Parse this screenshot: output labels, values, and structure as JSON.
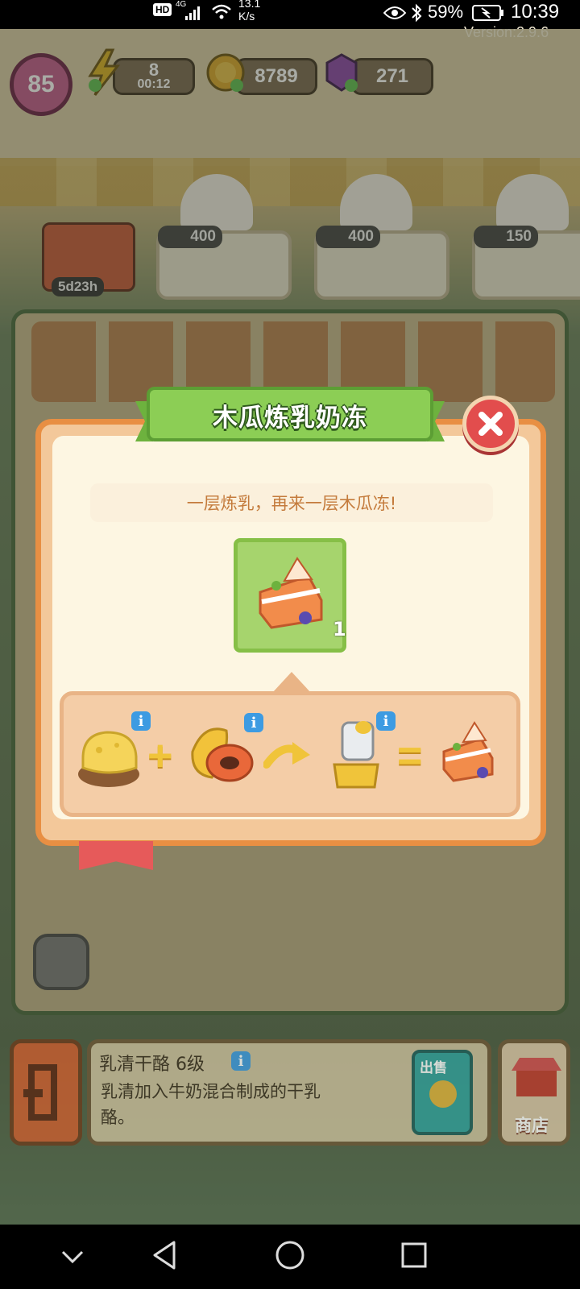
{
  "status_bar": {
    "network_label": "HD",
    "signal_label": "4G",
    "speed_value": "13.1",
    "speed_unit": "K/s",
    "battery_percent": "59%",
    "time": "10:39"
  },
  "game": {
    "version": "Version:2.9.6",
    "level": "85",
    "energy": "8",
    "energy_timer": "00:12",
    "coins": "8789",
    "gems": "271",
    "event_timer": "5d23h",
    "customers": [
      {
        "price": "400"
      },
      {
        "price": "400"
      },
      {
        "price": "150"
      }
    ]
  },
  "modal": {
    "title": "木瓜炼乳奶冻",
    "description": "一层炼乳，再来一层木瓜冻!",
    "result_level": "1",
    "recipe_ops": {
      "plus": "+",
      "equals": "="
    }
  },
  "bottom": {
    "item_name": "乳清干酪 6级",
    "item_desc_line1": "乳清加入牛奶混合制成的干乳",
    "item_desc_line2": "酪。",
    "sell_label": "出售",
    "shop_label": "商店"
  },
  "colors": {
    "modal_border": "#e88f43",
    "ribbon_green": "#7fc24a",
    "close_red": "#e24d4d",
    "info_blue": "#3d9be2"
  }
}
